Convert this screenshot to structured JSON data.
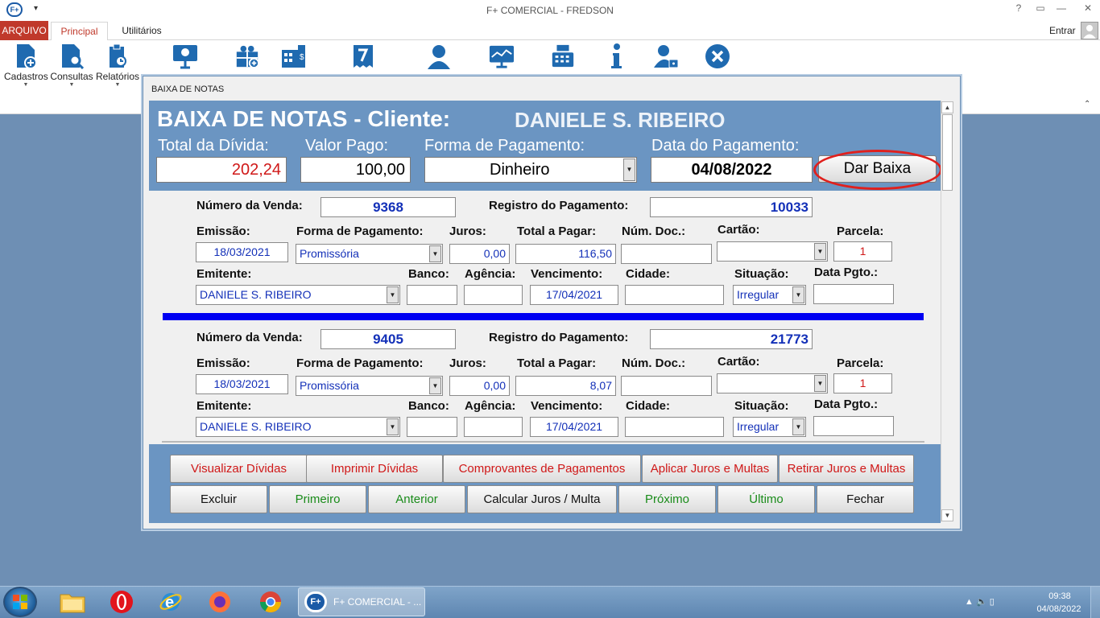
{
  "window": {
    "title": "F+ COMERCIAL - FREDSON",
    "app_icon": "F+",
    "help": "?",
    "restore_ribbon": "▭",
    "minimize": "—",
    "maximize": "❐",
    "close": "✕"
  },
  "menu": {
    "arquivo": "ARQUIVO",
    "principal": "Principal",
    "utilitarios": "Utilitários",
    "entrar": "Entrar"
  },
  "ribbon": {
    "buttons": [
      {
        "label": "Cadastros",
        "icon": "cadastros-icon"
      },
      {
        "label": "Consultas",
        "icon": "consultas-icon"
      },
      {
        "label": "Relatórios",
        "icon": "relatorios-icon"
      }
    ],
    "icons": [
      "monitor-icon",
      "gift-icon",
      "calculator-icon",
      "invoice-icon",
      "user-icon",
      "chart-monitor-icon",
      "cash-register-icon",
      "info-icon",
      "user-lock-icon",
      "close-circle-icon"
    ]
  },
  "dialog": {
    "title": "BAIXA DE NOTAS",
    "header_title": "BAIXA DE NOTAS - Cliente:",
    "client_name": "DANIELE S. RIBEIRO",
    "labels": {
      "total": "Total da Dívida:",
      "pago": "Valor Pago:",
      "forma": "Forma de Pagamento:",
      "data": "Data do Pagamento:"
    },
    "values": {
      "total": "202,24",
      "pago": "100,00",
      "forma": "Dinheiro",
      "data": "04/08/2022"
    },
    "dar_baixa": "Dar Baixa"
  },
  "field_labels": {
    "numero_venda": "Número da Venda:",
    "registro": "Registro do Pagamento:",
    "emissao": "Emissão:",
    "forma": "Forma de Pagamento:",
    "juros": "Juros:",
    "total_pagar": "Total a Pagar:",
    "num_doc": "Núm. Doc.:",
    "cartao": "Cartão:",
    "parcela": "Parcela:",
    "emitente": "Emitente:",
    "banco": "Banco:",
    "agencia": "Agência:",
    "vencimento": "Vencimento:",
    "cidade": "Cidade:",
    "situacao": "Situação:",
    "data_pgto": "Data Pgto.:"
  },
  "records": [
    {
      "numero_venda": "9368",
      "registro": "10033",
      "emissao": "18/03/2021",
      "forma": "Promissória",
      "juros": "0,00",
      "total_pagar": "116,50",
      "num_doc": "",
      "cartao": "",
      "parcela": "1",
      "emitente": "DANIELE S. RIBEIRO",
      "banco": "",
      "agencia": "",
      "vencimento": "17/04/2021",
      "cidade": "",
      "situacao": "Irregular",
      "data_pgto": ""
    },
    {
      "numero_venda": "9405",
      "registro": "21773",
      "emissao": "18/03/2021",
      "forma": "Promissória",
      "juros": "0,00",
      "total_pagar": "8,07",
      "num_doc": "",
      "cartao": "",
      "parcela": "1",
      "emitente": "DANIELE S. RIBEIRO",
      "banco": "",
      "agencia": "",
      "vencimento": "17/04/2021",
      "cidade": "",
      "situacao": "Irregular",
      "data_pgto": ""
    }
  ],
  "buttons_row1": [
    "Visualizar Dívidas",
    "Imprimir Dívidas",
    "Comprovantes de Pagamentos",
    "Aplicar Juros e Multas",
    "Retirar Juros e Multas"
  ],
  "buttons_row2": [
    "Excluir",
    "Primeiro",
    "Anterior",
    "Calcular Juros / Multa",
    "Próximo",
    "Último",
    "Fechar"
  ],
  "taskbar": {
    "active_label": "F+ COMERCIAL - ...",
    "active_icon": "F+",
    "time": "09:38",
    "date": "04/08/2022",
    "tray_symbols": "▲ 🔈 ▯"
  },
  "colors": {
    "accent_red": "#c0392b",
    "header_blue": "#6b95c2",
    "value_blue": "#1330b8",
    "separator": "#0000f2"
  }
}
